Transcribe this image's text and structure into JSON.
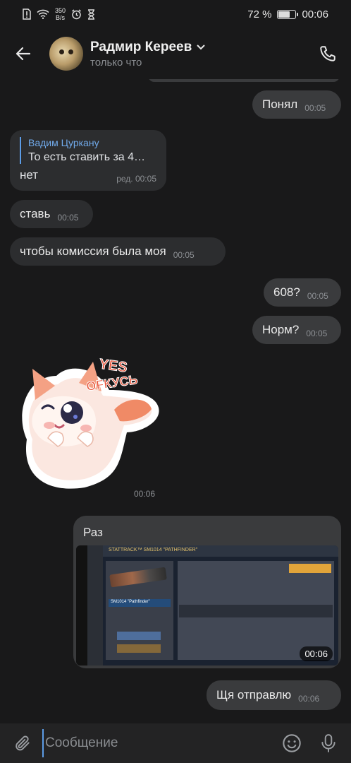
{
  "status_bar": {
    "net_speed_value": "350",
    "net_speed_unit": "B/s",
    "battery": "72 %",
    "battery_level": 0.72,
    "time": "00:06"
  },
  "header": {
    "name": "Радмир Кереев",
    "status": "только что"
  },
  "messages": [
    {
      "text": "Понял",
      "time": "00:05"
    },
    {
      "quote_name": "Вадим Цуркану",
      "quote_text": "То есть ставить за 4…",
      "text": "нет",
      "time": "ред. 00:05"
    },
    {
      "text": "ставь",
      "time": "00:05"
    },
    {
      "text": "чтобы комиссия была моя",
      "time": "00:05"
    },
    {
      "text": "608?",
      "time": "00:05"
    },
    {
      "text": "Норм?",
      "time": "00:05"
    },
    {
      "sticker_text": "YES OFКУСЬ",
      "time": "00:06"
    },
    {
      "text": "Раз",
      "video_duration": "00:06"
    },
    {
      "text": "Щя отправлю",
      "time": "00:06"
    }
  ],
  "video_thumb": {
    "title": "STATTRACK™ SM1014 \"PATHFINDER\"",
    "weapon_label": "SM1014 \"Pathfinder\""
  },
  "composer": {
    "placeholder": "Сообщение"
  }
}
